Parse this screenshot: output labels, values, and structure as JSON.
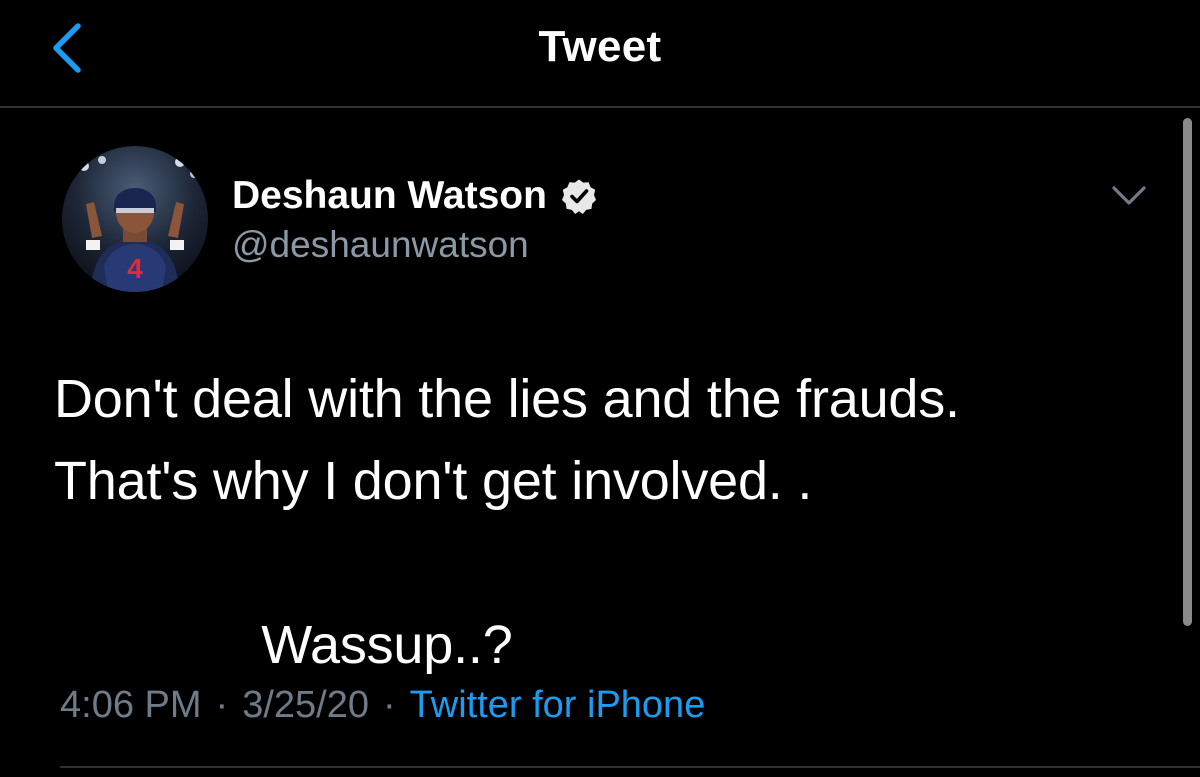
{
  "header": {
    "title": "Tweet",
    "back_icon": "chevron-left-icon"
  },
  "author": {
    "display_name": "Deshaun Watson",
    "handle": "@deshaunwatson",
    "verified": true,
    "verified_icon": "verified-badge-icon",
    "menu_icon": "chevron-down-icon"
  },
  "tweet": {
    "text": "Don't deal with the lies and the frauds.\nThat's why I don't get involved. .\n\n              Wassup..?",
    "time": "4:06 PM",
    "date": "3/25/20",
    "source": "Twitter for iPhone",
    "separator": "·"
  },
  "colors": {
    "background": "#000000",
    "accent": "#1d9bf0",
    "muted": "#6e7c88",
    "divider": "#2f3336"
  }
}
